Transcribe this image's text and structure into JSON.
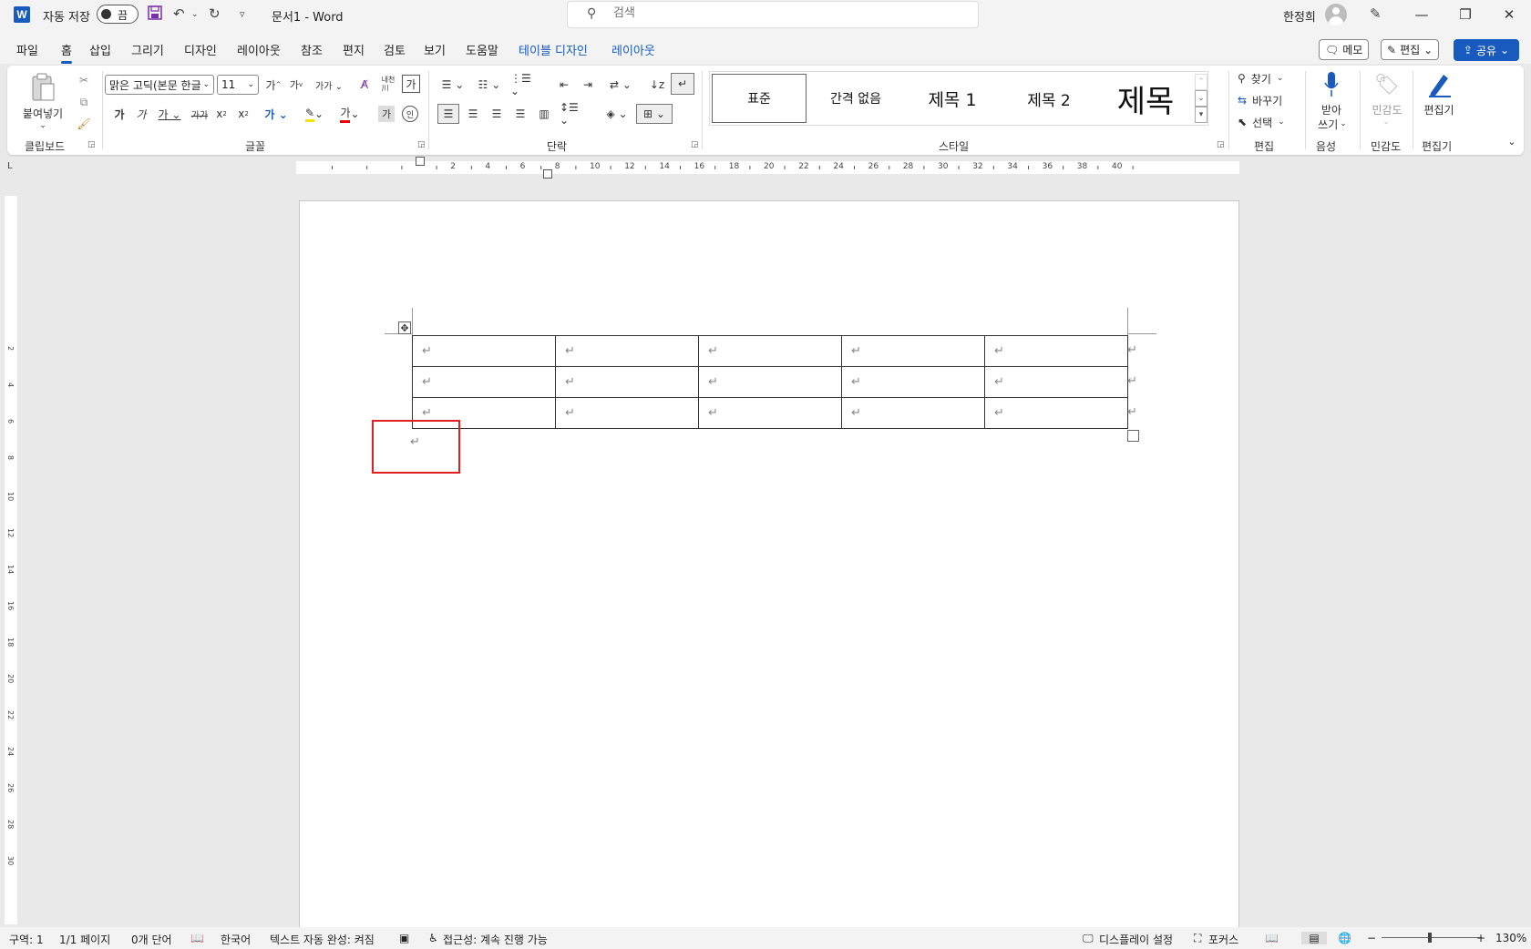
{
  "titlebar": {
    "autosave_label": "자동 저장",
    "autosave_state": "끔",
    "doc_title": "문서1  -  Word",
    "search_placeholder": "검색",
    "user_name": "한정희"
  },
  "menu_tabs": [
    "파일",
    "홈",
    "삽입",
    "그리기",
    "디자인",
    "레이아웃",
    "참조",
    "편지",
    "검토",
    "보기",
    "도움말",
    "테이블 디자인",
    "레이아웃"
  ],
  "active_tab": "홈",
  "header_buttons": {
    "memo": "메모",
    "edit": "편집",
    "share": "공유"
  },
  "ribbon": {
    "clipboard": {
      "paste_label": "붙여넣기",
      "group": "클립보드"
    },
    "font": {
      "name": "맑은 고딕(본문 한글)",
      "size": "11",
      "group": "글꼴"
    },
    "paragraph": {
      "group": "단락"
    },
    "styles": {
      "group": "스타일",
      "items": [
        "표준",
        "간격 없음",
        "제목 1",
        "제목 2",
        "제목"
      ]
    },
    "editing": {
      "find": "찾기",
      "replace": "바꾸기",
      "select": "선택",
      "group": "편집"
    },
    "voice": {
      "dictate_line1": "받아",
      "dictate_line2": "쓰기",
      "group": "음성"
    },
    "sensitivity": {
      "label": "민감도",
      "group": "민감도"
    },
    "editor": {
      "label": "편집기",
      "group": "편집기"
    }
  },
  "ruler": {
    "h_numbers": [
      "2",
      "4",
      "6",
      "8",
      "10",
      "12",
      "14",
      "16",
      "18",
      "20",
      "22",
      "24",
      "26",
      "28",
      "30",
      "32",
      "34",
      "36",
      "38",
      "40"
    ],
    "v_numbers": [
      "2",
      "4",
      "6",
      "8",
      "10",
      "12",
      "14",
      "16",
      "18",
      "20",
      "22",
      "24",
      "26",
      "28",
      "30"
    ]
  },
  "document": {
    "table": {
      "rows": 3,
      "cols": 5,
      "cell_mark": "↵"
    },
    "paragraph_mark": "↵"
  },
  "statusbar": {
    "section": "구역: 1",
    "page": "1/1 페이지",
    "words": "0개 단어",
    "language": "한국어",
    "autocomplete": "텍스트 자동 완성: 켜짐",
    "accessibility": "접근성: 계속 진행 가능",
    "display_settings": "디스플레이 설정",
    "focus": "포커스",
    "zoom": "130%"
  },
  "colors": {
    "accent": "#185abd",
    "highlight_box": "#e02020"
  }
}
